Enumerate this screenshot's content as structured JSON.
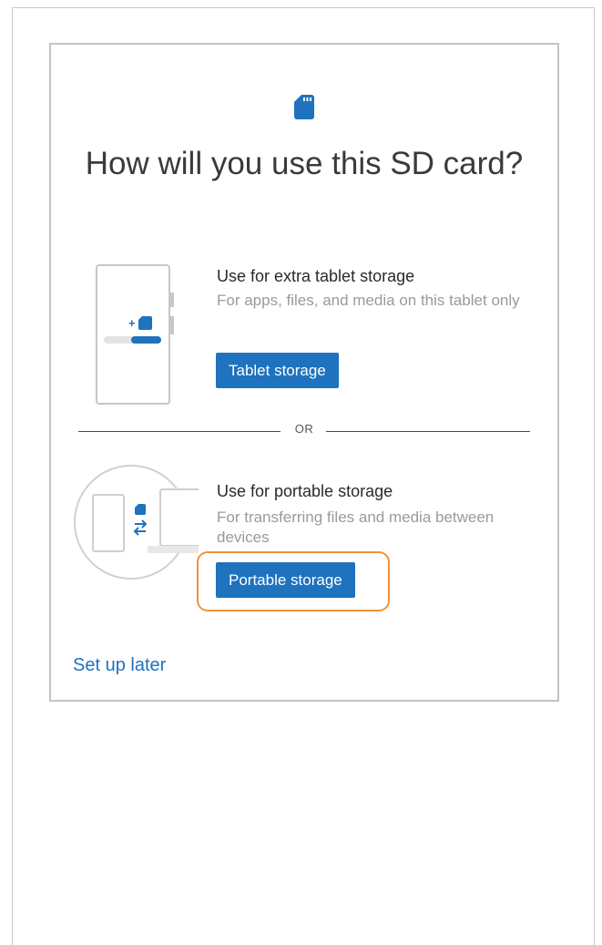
{
  "dialog": {
    "title": "How will you use this SD card?",
    "options": [
      {
        "title": "Use for extra tablet storage",
        "description": "For apps, files, and media on this tablet only",
        "button_label": "Tablet storage"
      },
      {
        "title": "Use for portable storage",
        "description": "For transferring files and media between devices",
        "button_label": "Portable storage"
      }
    ],
    "divider_label": "OR",
    "setup_later_label": "Set up later"
  },
  "icons": {
    "header": "sd-card-icon",
    "option_1_illustration": "tablet-internal-storage-illustration",
    "option_2_illustration": "portable-transfer-illustration"
  },
  "colors": {
    "accent": "#1e72be",
    "highlight": "#f0913a",
    "title_text": "#3a3a3a",
    "secondary_text": "#9a9a9a"
  }
}
